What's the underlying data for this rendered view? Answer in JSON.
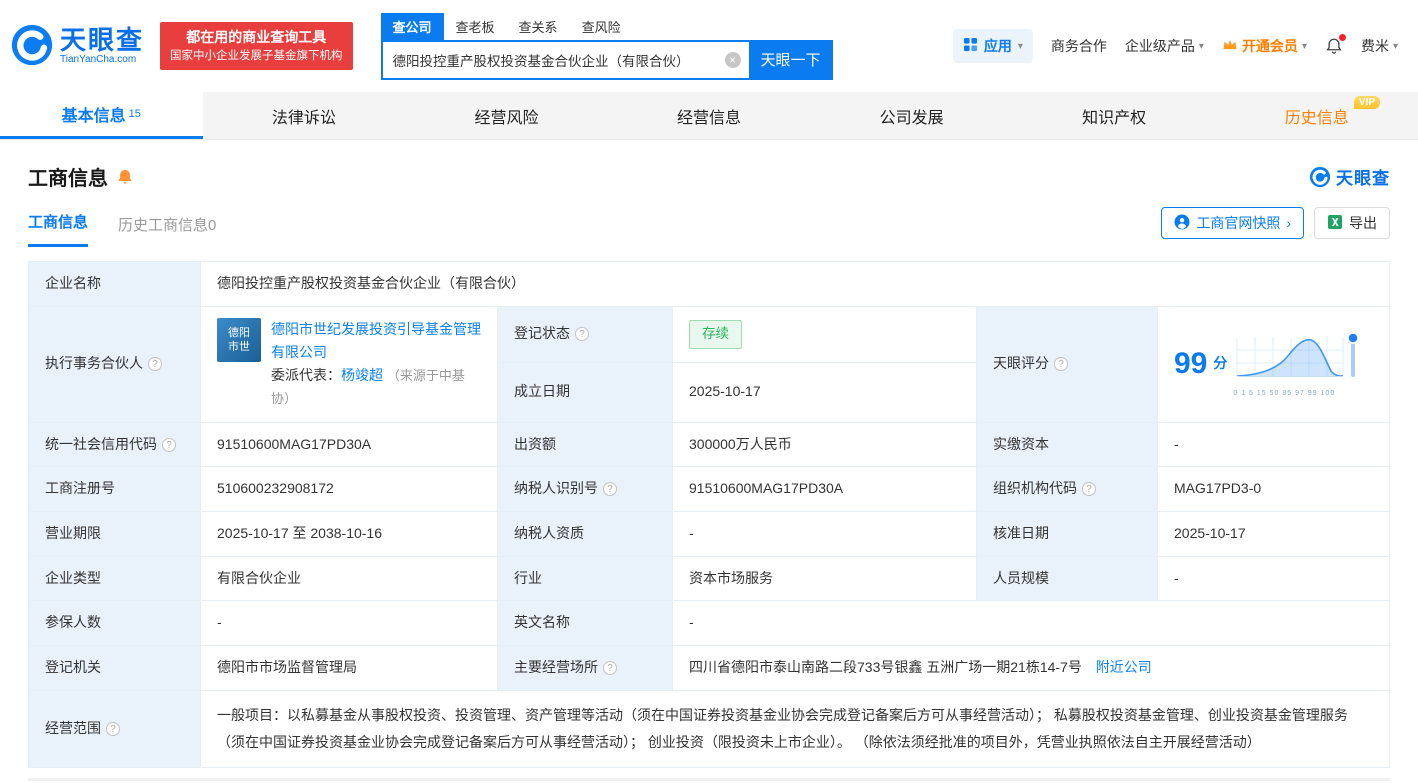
{
  "header": {
    "logo": {
      "brand": "天眼查",
      "domain": "TianYanCha.com"
    },
    "slogan_line1": "都在用的商业查询工具",
    "slogan_line2": "国家中小企业发展子基金旗下机构",
    "search": {
      "tabs": [
        {
          "label": "查公司",
          "active": true
        },
        {
          "label": "查老板",
          "active": false
        },
        {
          "label": "查关系",
          "active": false
        },
        {
          "label": "查风险",
          "active": false
        }
      ],
      "value": "德阳投控重产股权投资基金合伙企业（有限合伙）",
      "button": "天眼一下"
    },
    "menu": {
      "apps": "应用",
      "cooperation": "商务合作",
      "enterprise": "企业级产品",
      "vip": "开通会员",
      "user": "费米"
    }
  },
  "nav": {
    "tabs": [
      {
        "label": "基本信息",
        "count": "15",
        "active": true
      },
      {
        "label": "法律诉讼"
      },
      {
        "label": "经营风险"
      },
      {
        "label": "经营信息"
      },
      {
        "label": "公司发展"
      },
      {
        "label": "知识产权"
      },
      {
        "label": "历史信息",
        "vip": true
      }
    ],
    "vip_badge": "VIP"
  },
  "section": {
    "title": "工商信息",
    "brand": "天眼查",
    "subtabs": [
      {
        "label": "工商信息",
        "active": true
      },
      {
        "label": "历史工商信息0",
        "active": false
      }
    ],
    "snapshot_button": "工商官网快照",
    "export_button": "导出"
  },
  "table": {
    "company_name": {
      "label": "企业名称",
      "value": "德阳投控重产股权投资基金合伙企业（有限合伙）"
    },
    "partner": {
      "label": "执行事务合伙人",
      "logo_line1": "德阳",
      "logo_line2": "市世",
      "name": "德阳市世纪发展投资引导基金管理有限公司",
      "rep_label": "委派代表：",
      "rep_name": "杨竣超",
      "rep_source": "（来源于中基协）"
    },
    "reg_status": {
      "label": "登记状态",
      "value": "存续"
    },
    "establish_date": {
      "label": "成立日期",
      "value": "2025-10-17"
    },
    "score": {
      "label": "天眼评分",
      "value": "99",
      "unit": "分",
      "axis": "0 1 5 15 50 85 97 99 100"
    },
    "credit_code": {
      "label": "统一社会信用代码",
      "value": "91510600MAG17PD30A"
    },
    "capital": {
      "label": "出资额",
      "value": "300000万人民币"
    },
    "paid_capital": {
      "label": "实缴资本",
      "value": "-"
    },
    "reg_number": {
      "label": "工商注册号",
      "value": "510600232908172"
    },
    "taxpayer_id": {
      "label": "纳税人识别号",
      "value": "91510600MAG17PD30A"
    },
    "org_code": {
      "label": "组织机构代码",
      "value": "MAG17PD3-0"
    },
    "business_term": {
      "label": "营业期限",
      "value": "2025-10-17 至 2038-10-16"
    },
    "taxpayer_qualification": {
      "label": "纳税人资质",
      "value": "-"
    },
    "approval_date": {
      "label": "核准日期",
      "value": "2025-10-17"
    },
    "company_type": {
      "label": "企业类型",
      "value": "有限合伙企业"
    },
    "industry": {
      "label": "行业",
      "value": "资本市场服务"
    },
    "staff_size": {
      "label": "人员规模",
      "value": "-"
    },
    "insured_count": {
      "label": "参保人数",
      "value": "-"
    },
    "english_name": {
      "label": "英文名称",
      "value": "-"
    },
    "reg_authority": {
      "label": "登记机关",
      "value": "德阳市市场监督管理局"
    },
    "business_address": {
      "label": "主要经营场所",
      "value": "四川省德阳市泰山南路二段733号银鑫 五洲广场一期21栋14-7号",
      "nearby_link": "附近公司"
    },
    "business_scope": {
      "label": "经营范围",
      "value": "一般项目：以私募基金从事股权投资、投资管理、资产管理等活动（须在中国证券投资基金业协会完成登记备案后方可从事经营活动）； 私募股权投资基金管理、创业投资基金管理服务（须在中国证券投资基金业协会完成登记备案后方可从事经营活动）； 创业投资（限投资未上市企业）。 （除依法须经批准的项目外，凭营业执照依法自主开展经营活动）"
    }
  },
  "icons": {
    "clear": "×",
    "caret_down": "▾",
    "arrow_right": "›"
  },
  "colors": {
    "brand_blue": "#0a7cf0",
    "link_blue": "#0b80ee",
    "orange": "#ff8000",
    "status_green": "#2ab55a",
    "banner_red": "#e83e3e",
    "label_bg": "#e9f1fb"
  }
}
